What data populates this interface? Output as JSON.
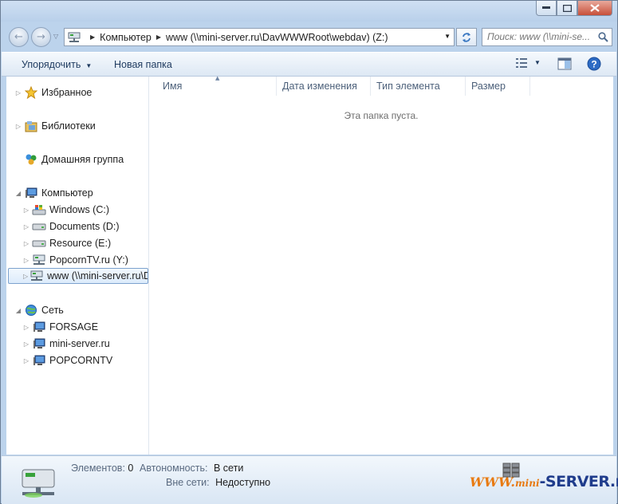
{
  "address": {
    "crumbs": [
      "Компьютер",
      "www (\\\\mini-server.ru\\DavWWWRoot\\webdav) (Z:)"
    ]
  },
  "search": {
    "placeholder": "Поиск: www (\\\\mini-se..."
  },
  "toolbar": {
    "organize_label": "Упорядочить",
    "new_folder_label": "Новая папка"
  },
  "nav": {
    "favorites": "Избранное",
    "libraries": "Библиотеки",
    "homegroup": "Домашняя группа",
    "computer": "Компьютер",
    "drives": [
      {
        "label": "Windows (C:)",
        "icon": "windows-drive-icon"
      },
      {
        "label": "Documents (D:)",
        "icon": "drive-icon"
      },
      {
        "label": "Resource (E:)",
        "icon": "drive-icon"
      },
      {
        "label": "PopcornTV.ru (Y:)",
        "icon": "network-drive-icon"
      },
      {
        "label": "www (\\\\mini-server.ru\\DavWWWRoot\\webdav) (Z:)",
        "icon": "network-drive-icon"
      }
    ],
    "network": "Сеть",
    "hosts": [
      "FORSAGE",
      "mini-server.ru",
      "POPCORNTV"
    ]
  },
  "columns": [
    "Имя",
    "Дата изменения",
    "Тип элемента",
    "Размер"
  ],
  "empty_message": "Эта папка пуста.",
  "details": {
    "items_label": "Элементов:",
    "items_count": "0",
    "offline_avail_label": "Автономность:",
    "offline_avail_value": "В сети",
    "offline_label": "Вне сети:",
    "offline_value": "Недоступно"
  },
  "watermark": {
    "www": "WWW.",
    "mini": "mini",
    "server": "-SERVER.ru"
  },
  "colors": {
    "accent": "#1e3a5f",
    "selection": "#dcebfb",
    "watermark_orange": "#e87a10"
  }
}
